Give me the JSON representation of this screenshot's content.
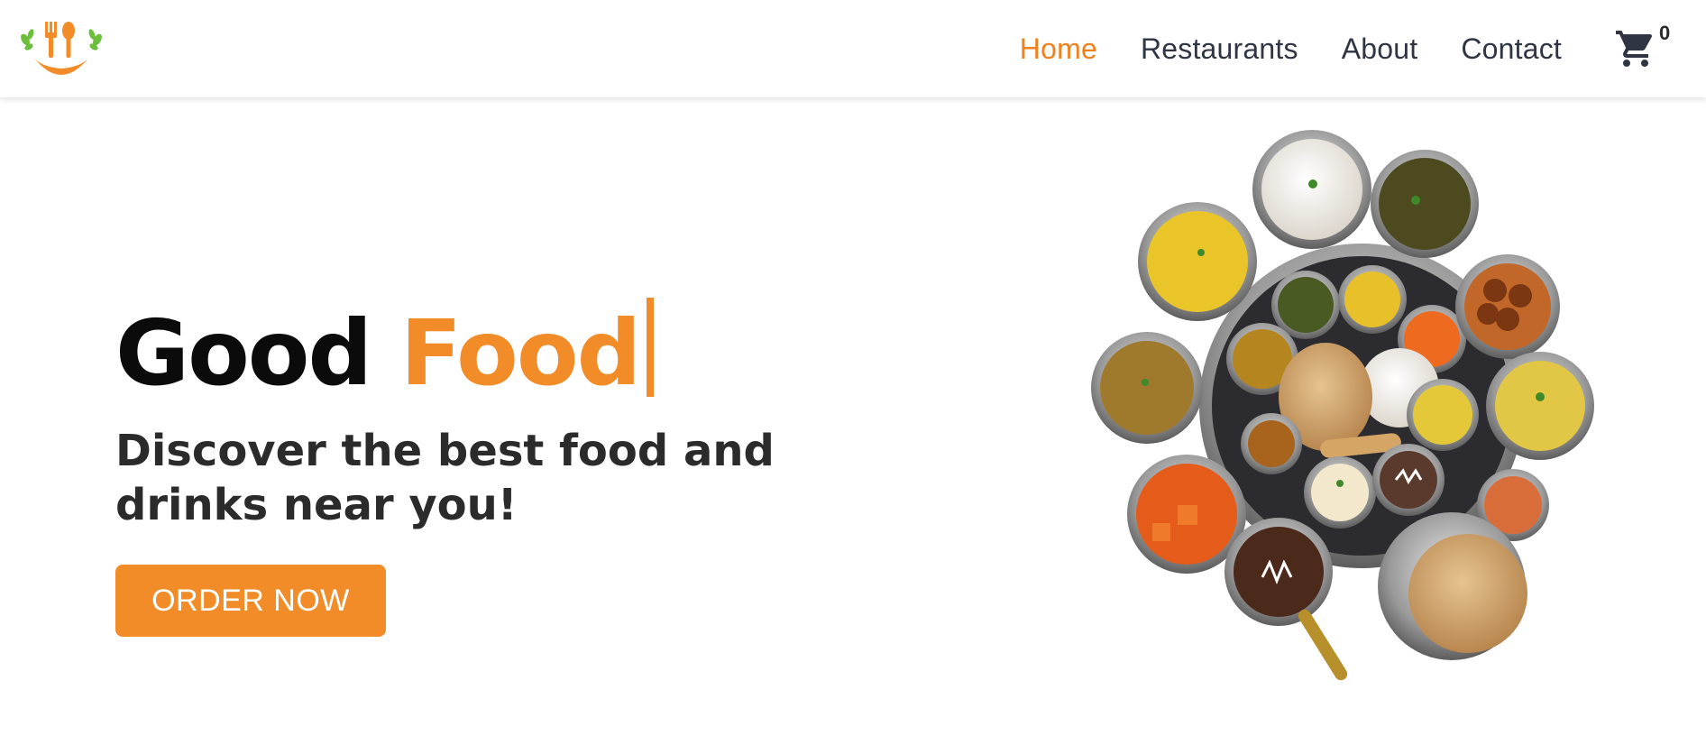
{
  "nav": {
    "links": [
      {
        "label": "Home",
        "active": true
      },
      {
        "label": "Restaurants",
        "active": false
      },
      {
        "label": "About",
        "active": false
      },
      {
        "label": "Contact",
        "active": false
      }
    ],
    "cart": {
      "count": "0",
      "icon": "cart-icon"
    }
  },
  "logo": {
    "icon": "fork-spoon-smile-logo"
  },
  "hero": {
    "headline_word1": "Good",
    "headline_word2": "Food",
    "subheadline": "Discover the best food and drinks near you!",
    "cta_label": "ORDER NOW"
  },
  "image": {
    "subject": "thali-food-platter"
  },
  "colors": {
    "accent": "#f28c28",
    "nav_active": "#f0811e",
    "nav_text": "#2f3542",
    "heading": "#0b0b0b",
    "subheading": "#2b2b2b",
    "logo_green": "#6cbf3a"
  }
}
